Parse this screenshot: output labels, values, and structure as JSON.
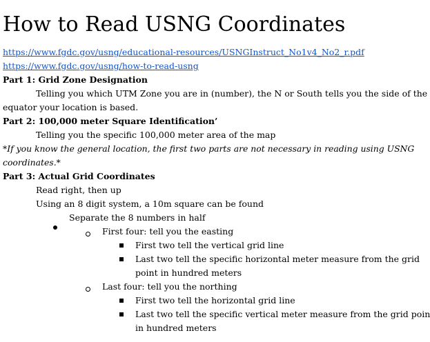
{
  "title": "How to Read USNG Coordinates",
  "links": [
    "https://www.fgdc.gov/usng/educational-resources/USNGInstruct_No1v4_No2_r.pdf",
    "https://www.fgdc.gov/usng/how-to-read-usng"
  ],
  "part1": {
    "heading": "Part 1: Grid Zone Designation",
    "line1": "Telling you which UTM Zone you are in (number), the N or South tells you the side of the",
    "line2": "equator your location is based."
  },
  "part2": {
    "heading": "Part 2: 100,000 meter Square Identification’",
    "line1": "Telling you the specific 100,000 meter area of the map"
  },
  "note": {
    "line1": "*If you know the general location, the first two parts are not necessary in reading using USNG",
    "line2": "coordinates.*"
  },
  "part3": {
    "heading": "Part 3: Actual Grid Coordinates",
    "line1": "Read right, then up",
    "line2": "Using an 8 digit system, a 10m square can be found",
    "bullet": "Separate the 8 numbers in half",
    "first_four": {
      "label": "First four: tell you the easting",
      "items": [
        "First two tell the vertical grid line",
        "Last two tell the specific horizontal  meter measure from the grid",
        "point in hundred meters"
      ]
    },
    "last_four": {
      "label": "Last four: tell you the northing",
      "items": [
        "First two tell the horizontal grid line",
        "Last two tell the specific vertical meter measure from the grid point",
        "in hundred meters"
      ]
    }
  }
}
